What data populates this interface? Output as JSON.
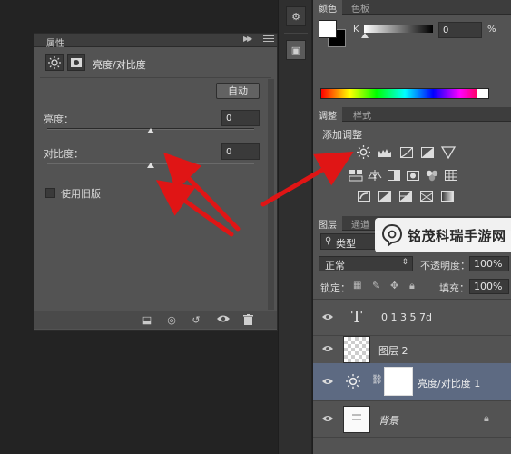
{
  "properties_panel": {
    "tab_label": "属性",
    "adjustment_title": "亮度/对比度",
    "auto_button": "自动",
    "brightness_label": "亮度：",
    "brightness_value": "0",
    "brightness_slider": 0.5,
    "contrast_label": "对比度：",
    "contrast_value": "0",
    "contrast_slider": 0.5,
    "legacy_label": "使用旧版"
  },
  "color_panel": {
    "tabs": [
      "颜色",
      "色板"
    ],
    "channel_label": "K",
    "channel_value": "0",
    "unit": "%"
  },
  "adjustments_panel": {
    "tabs": [
      "调整",
      "样式"
    ],
    "title": "添加调整"
  },
  "layers_panel": {
    "tabs": [
      "图层",
      "通道"
    ],
    "filter_kind": "类型",
    "blend_mode": "正常",
    "opacity_label": "不透明度：",
    "opacity_value": "100%",
    "lock_label": "锁定：",
    "fill_label": "填充：",
    "fill_value": "100%",
    "layers": [
      {
        "name": "0 1 3 5 7d",
        "kind": "text"
      },
      {
        "name": "图层 2",
        "kind": "pixel"
      },
      {
        "name": "亮度/对比度 1",
        "kind": "adjustment"
      },
      {
        "name": "背景",
        "kind": "background"
      }
    ]
  },
  "watermark": {
    "text": "铭茂科瑞手游网"
  },
  "colors": {
    "arrow": "#e01515",
    "panel": "#535353",
    "selected_layer": "#5d6a82"
  }
}
